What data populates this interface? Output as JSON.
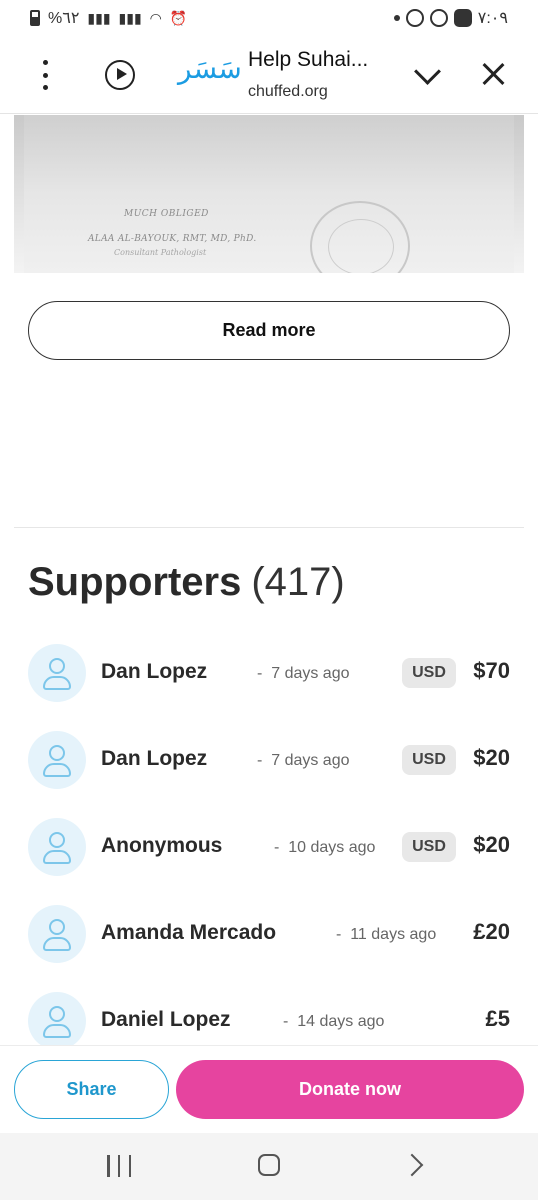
{
  "status_bar": {
    "battery_text": "%٦٢",
    "time": "٧:٠٩"
  },
  "browser": {
    "logo_text": "سَسَر",
    "title": "Help Suhai...",
    "domain": "chuffed.org"
  },
  "document_image": {
    "line1": "MUCH OBLIGED",
    "line2": "ALAA AL-BAYOUK, RMT, MD, PhD.",
    "line3": "Consultant Pathologist"
  },
  "read_more_label": "Read more",
  "supporters": {
    "heading": "Supporters",
    "count": "(417)",
    "items": [
      {
        "name": "Dan Lopez",
        "time": "7 days ago",
        "currency": "USD",
        "amount": "$70"
      },
      {
        "name": "Dan Lopez",
        "time": "7 days ago",
        "currency": "USD",
        "amount": "$20"
      },
      {
        "name": "Anonymous",
        "time": "10 days ago",
        "currency": "USD",
        "amount": "$20"
      },
      {
        "name": "Amanda Mercado",
        "time": "11 days ago",
        "currency": "",
        "amount": "£20"
      },
      {
        "name": "Daniel Lopez",
        "time": "14 days ago",
        "currency": "",
        "amount": "£5"
      }
    ],
    "separator": "-"
  },
  "actions": {
    "share_label": "Share",
    "donate_label": "Donate now"
  },
  "colors": {
    "donate": "#e6449f",
    "share": "#1f97cc",
    "brand_logo": "#1b9ce2"
  }
}
